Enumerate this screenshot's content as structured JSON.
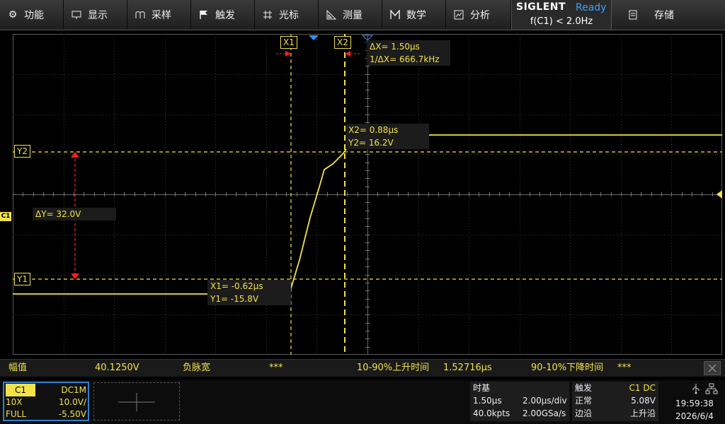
{
  "menu": [
    {
      "label": "功能",
      "icon": "gear-icon"
    },
    {
      "label": "显示",
      "icon": "monitor-icon"
    },
    {
      "label": "采样",
      "icon": "sample-icon"
    },
    {
      "label": "触发",
      "icon": "flag-icon"
    },
    {
      "label": "光标",
      "icon": "crosshair-icon"
    },
    {
      "label": "测量",
      "icon": "ruler-icon"
    },
    {
      "label": "数学",
      "icon": "math-icon"
    },
    {
      "label": "分析",
      "icon": "analysis-icon"
    }
  ],
  "brand": {
    "name": "SIGLENT",
    "status": "Ready",
    "freq": "f(C1) < 2.0Hz"
  },
  "save": {
    "label": "存储",
    "icon": "save-icon"
  },
  "cursors": {
    "x1_tag": "X1",
    "x2_tag": "X2",
    "y1_tag": "Y1",
    "y2_tag": "Y2",
    "delta_x": "ΔX= 1.50μs",
    "inv_delta_x": "1/ΔX= 666.7kHz",
    "x2_value": "X2= 0.88μs",
    "y2_value": "Y2= 16.2V",
    "x1_value": "X1= -0.62μs",
    "y1_value": "Y1= -15.8V",
    "delta_y": "ΔY= 32.0V",
    "channel_marker": "C1"
  },
  "measurements": [
    {
      "name": "幅值",
      "value": "40.1250V"
    },
    {
      "name": "负脉宽",
      "value": "***"
    },
    {
      "name": "10-90%上升时间",
      "value": "1.52716μs"
    },
    {
      "name": "90-10%下降时间",
      "value": "***"
    }
  ],
  "channel": {
    "name": "C1",
    "coupling": "DC1M",
    "probe": "10X",
    "scale": "10.0V/",
    "bandwidth": "FULL",
    "offset": "-5.50V"
  },
  "timebase": {
    "title": "时基",
    "delay": "1.50μs",
    "scale": "2.00μs/div",
    "depth": "40.0kpts",
    "rate": "2.00GSa/s"
  },
  "trigger": {
    "title": "触发",
    "source": "C1 DC",
    "mode": "正常",
    "level": "5.08V",
    "type": "边沿",
    "slope": "上升沿"
  },
  "system": {
    "time": "19:59:38",
    "date": "2026/6/4"
  },
  "colors": {
    "trace": "#f2e24a",
    "cursor": "#f2e24a",
    "marker_red": "#ff2020",
    "accent_blue": "#3aa0ff"
  }
}
